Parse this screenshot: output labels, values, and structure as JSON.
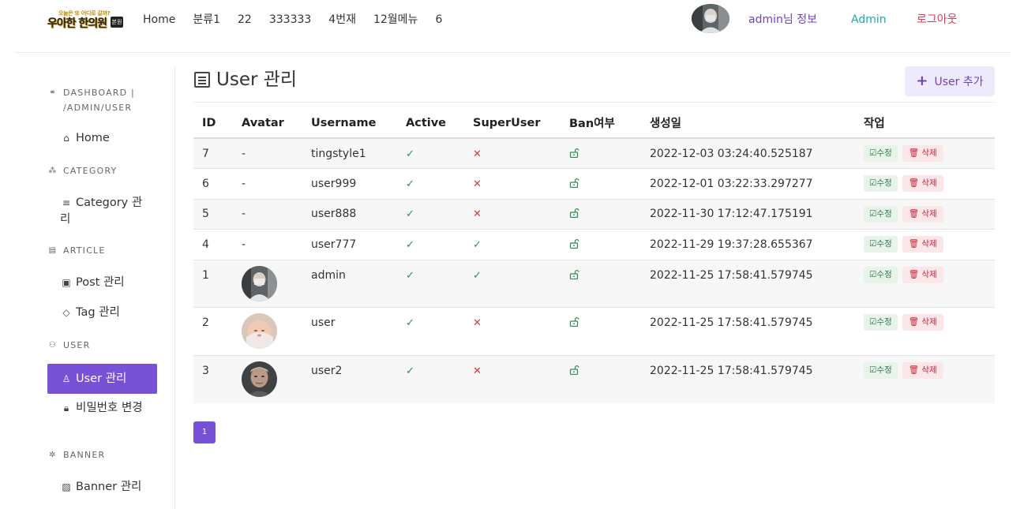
{
  "header": {
    "logo": {
      "top_text": "오늘은 또 어디로 갈까?",
      "main_text": "우아한 한의원",
      "badge": "본원"
    },
    "menu": [
      "Home",
      "분류1",
      "22",
      "333333",
      "4번재",
      "12월메뉴",
      "6"
    ],
    "user_info": "admin님 정보",
    "admin_link": "Admin",
    "logout_link": "로그아웃"
  },
  "sidebar": {
    "dashboard_heading": "DASHBOARD | /ADMIN/USER",
    "dashboard_home": "Home",
    "category_heading": "CATEGORY",
    "category_item": "Category 관리",
    "article_heading": "ARTICLE",
    "post_item": "Post 관리",
    "tag_item": "Tag 관리",
    "user_heading": "USER",
    "user_item": "User 관리",
    "password_item": "비밀번호 변경",
    "banner_heading": "BANNER",
    "banner_item": "Banner 관리"
  },
  "main": {
    "title": "User 관리",
    "add_button": "User 추가",
    "columns": [
      "ID",
      "Avatar",
      "Username",
      "Active",
      "SuperUser",
      "Ban여부",
      "생성일",
      "작업"
    ],
    "rows": [
      {
        "id": "7",
        "avatar": "-",
        "username": "tingstyle1",
        "active": "✓",
        "superuser": "✕",
        "created": "2022-12-03 03:24:40.525187"
      },
      {
        "id": "6",
        "avatar": "-",
        "username": "user999",
        "active": "✓",
        "superuser": "✕",
        "created": "2022-12-01 03:22:33.297277"
      },
      {
        "id": "5",
        "avatar": "-",
        "username": "user888",
        "active": "✓",
        "superuser": "✕",
        "created": "2022-11-30 17:12:47.175191"
      },
      {
        "id": "4",
        "avatar": "-",
        "username": "user777",
        "active": "✓",
        "superuser": "✓",
        "created": "2022-11-29 19:37:28.655367"
      },
      {
        "id": "1",
        "avatar": "",
        "username": "admin",
        "active": "✓",
        "superuser": "✓",
        "created": "2022-11-25 17:58:41.579745"
      },
      {
        "id": "2",
        "avatar": "",
        "username": "user",
        "active": "✓",
        "superuser": "✕",
        "created": "2022-11-25 17:58:41.579745"
      },
      {
        "id": "3",
        "avatar": "",
        "username": "user2",
        "active": "✓",
        "superuser": "✕",
        "created": "2022-11-25 17:58:41.579745"
      }
    ],
    "edit_label": "수정",
    "delete_label": "삭제"
  },
  "pagination": {
    "current": "1"
  },
  "colors": {
    "accent": "#7752d6",
    "link_purple": "#6f42c1",
    "link_teal": "#20a8a8",
    "link_red": "#e0365a",
    "check_green": "#2e8b57",
    "x_red": "#dc3545"
  }
}
